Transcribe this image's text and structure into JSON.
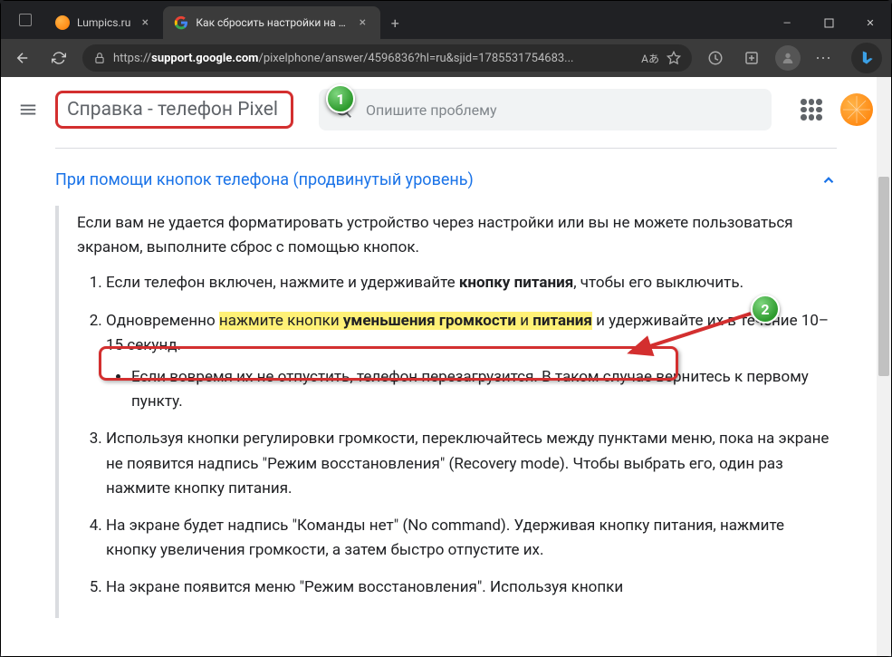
{
  "window": {
    "tabs": [
      {
        "title": "Lumpics.ru",
        "active": false
      },
      {
        "title": "Как сбросить настройки на теле",
        "active": true
      }
    ],
    "minimize": "—",
    "maximize": "▢",
    "close": "✕",
    "new_tab": "+"
  },
  "address": {
    "url_prefix": "https://",
    "url_host": "support.google.com",
    "url_rest": "/pixelphone/answer/4596836?hl=ru&sjid=1785531754683...",
    "reader_badge": "Aあ"
  },
  "help_header": {
    "page_title": "Справка - телефон Pixel",
    "search_placeholder": "Опишите проблему"
  },
  "accordion": {
    "title": "При помощи кнопок телефона (продвинутый уровень)"
  },
  "article": {
    "intro": "Если вам не удается форматировать устройство через настройки или вы не можете пользоваться экраном, выполните сброс с помощью кнопок.",
    "step1_a": "Если телефон включен, нажмите и удерживайте ",
    "step1_b": "кнопку питания",
    "step1_c": ", чтобы его выключить.",
    "step2_a": "Одновременно ",
    "step2_hl1": "нажмите кнопки ",
    "step2_hl2": "уменьшения громкости",
    "step2_hl3": " и ",
    "step2_hl4": "питания",
    "step2_b": " и удерживайте их в течение 10–15 секунд.",
    "step2_sub": "Если вовремя их не отпустить, телефон перезагрузится. В таком случае вернитесь к первому пункту.",
    "step3": "Используя кнопки регулировки громкости, переключайтесь между пунктами меню, пока на экране не появится надпись \"Режим восстановления\" (Recovery mode). Чтобы выбрать его, один раз нажмите кнопку питания.",
    "step4": "На экране будет надпись \"Команды нет\" (No command). Удерживая кнопку питания, нажмите кнопку увеличения громкости, а затем быстро отпустите их.",
    "step5": "На экране появится меню \"Режим восстановления\". Используя кнопки"
  },
  "callouts": {
    "one": "1",
    "two": "2"
  }
}
